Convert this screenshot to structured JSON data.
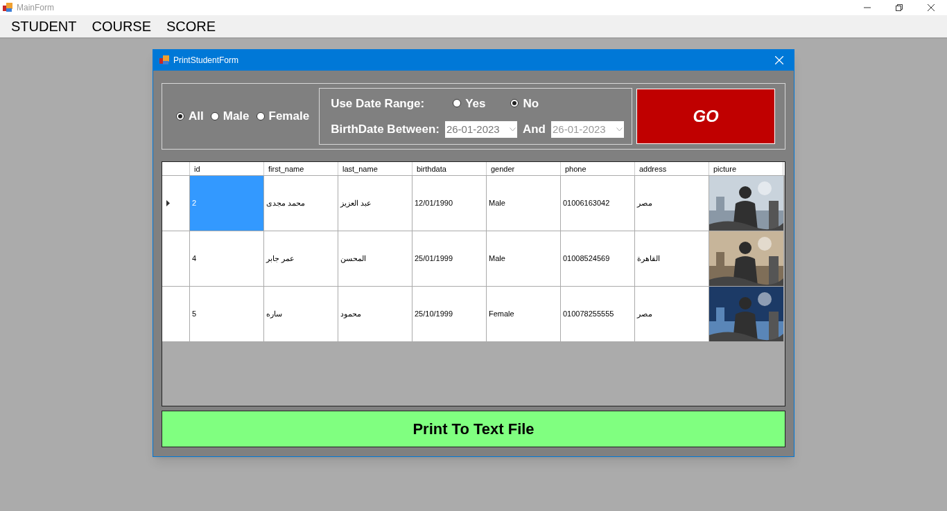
{
  "window": {
    "title": "MainForm"
  },
  "menu": [
    {
      "label": "STUDENT"
    },
    {
      "label": "COURSE"
    },
    {
      "label": "SCORE"
    }
  ],
  "dialog": {
    "title": "PrintStudentForm",
    "gender_options": [
      {
        "label": "All",
        "selected": true
      },
      {
        "label": "Male",
        "selected": false
      },
      {
        "label": "Female",
        "selected": false
      }
    ],
    "date_range": {
      "label": "Use Date Range:",
      "options": [
        {
          "label": "Yes",
          "selected": false
        },
        {
          "label": "No",
          "selected": true
        }
      ],
      "between_label": "BirthDate Between:",
      "from": "26-01-2023",
      "and_label": "And",
      "to": "26-01-2023"
    },
    "go_button": "GO",
    "table": {
      "columns": [
        "id",
        "first_name",
        "last_name",
        "birthdata",
        "gender",
        "phone",
        "address",
        "picture"
      ],
      "rows": [
        {
          "current": true,
          "cells": [
            {
              "text": "2",
              "selected": true
            },
            {
              "text": "محمد مجدى",
              "selected": false
            },
            {
              "text": "عبد العزيز",
              "selected": false
            },
            {
              "text": "12/01/1990",
              "selected": false
            },
            {
              "text": "Male",
              "selected": false
            },
            {
              "text": "01006163042",
              "selected": false
            },
            {
              "text": "مصر",
              "selected": false
            }
          ],
          "picture": {
            "kind": "picture"
          }
        },
        {
          "current": false,
          "cells": [
            {
              "text": "4",
              "selected": false
            },
            {
              "text": "عمر جابر",
              "selected": false
            },
            {
              "text": "المحسن",
              "selected": false
            },
            {
              "text": "25/01/1999",
              "selected": false
            },
            {
              "text": "Male",
              "selected": false
            },
            {
              "text": "01008524569",
              "selected": false
            },
            {
              "text": "القاهرة",
              "selected": false
            }
          ],
          "picture": {
            "kind": "picture"
          }
        },
        {
          "current": false,
          "cells": [
            {
              "text": "5",
              "selected": false
            },
            {
              "text": "ساره",
              "selected": false
            },
            {
              "text": "محمود",
              "selected": false
            },
            {
              "text": "25/10/1999",
              "selected": false
            },
            {
              "text": "Female",
              "selected": false
            },
            {
              "text": "010078255555",
              "selected": false
            },
            {
              "text": "مصر",
              "selected": false
            }
          ],
          "picture": {
            "kind": "picture"
          }
        }
      ]
    },
    "print_button": "Print To Text File"
  }
}
